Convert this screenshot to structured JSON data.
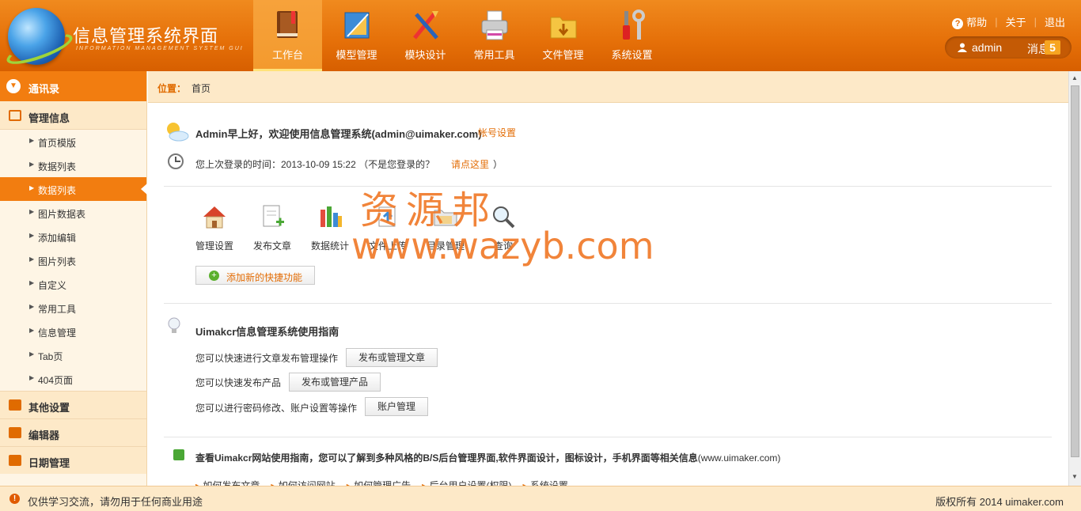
{
  "header": {
    "title": "信息管理系统界面",
    "subtitle": "INFORMATION MANAGEMENT SYSTEM GUI",
    "nav": [
      {
        "label": "工作台",
        "icon": "book-icon",
        "active": true
      },
      {
        "label": "模型管理",
        "icon": "ruler-icon",
        "active": false
      },
      {
        "label": "模块设计",
        "icon": "design-tools-icon",
        "active": false
      },
      {
        "label": "常用工具",
        "icon": "printer-icon",
        "active": false
      },
      {
        "label": "文件管理",
        "icon": "folder-icon",
        "active": false
      },
      {
        "label": "系统设置",
        "icon": "wrench-icon",
        "active": false
      }
    ],
    "top_links": {
      "help": "帮助",
      "about": "关于",
      "logout": "退出"
    },
    "user": {
      "name": "admin",
      "messages_label": "消息",
      "messages_count": "5"
    }
  },
  "sidebar": {
    "header": "通讯录",
    "group_main": "管理信息",
    "items": [
      "首页模版",
      "数据列表",
      "数据列表",
      "图片数据表",
      "添加编辑",
      "图片列表",
      "自定义",
      "常用工具",
      "信息管理",
      "Tab页",
      "404页面"
    ],
    "active_index": 2,
    "groups_bottom": [
      "其他设置",
      "编辑器",
      "日期管理"
    ]
  },
  "breadcrumb": {
    "label": "位置：",
    "home": "首页"
  },
  "main": {
    "welcome": "Admin早上好，欢迎使用信息管理系统(admin@uimaker.com)",
    "account_link": "帐号设置",
    "last_login_prefix": "您上次登录的时间：2013-10-09 15:22 （不是您登录的？",
    "last_login_link": "请点这里",
    "last_login_suffix": "）",
    "quick": [
      {
        "label": "管理设置",
        "icon": "home-icon"
      },
      {
        "label": "发布文章",
        "icon": "new-document-icon"
      },
      {
        "label": "数据统计",
        "icon": "bar-chart-icon"
      },
      {
        "label": "文件上传",
        "icon": "upload-icon"
      },
      {
        "label": "目录管理",
        "icon": "directory-icon"
      },
      {
        "label": "查询",
        "icon": "magnifier-icon"
      }
    ],
    "add_quick": "添加新的快捷功能",
    "guide_title": "Uimakcr信息管理系统使用指南",
    "guide_rows": [
      {
        "text": "您可以快速进行文章发布管理操作",
        "button": "发布或管理文章"
      },
      {
        "text": "您可以快速发布产品",
        "button": "发布或管理产品"
      },
      {
        "text": "您可以进行密码修改、账户设置等操作",
        "button": "账户管理"
      }
    ],
    "site_title_bold": "查看Uimakcr网站使用指南，您可以了解到多种风格的B/S后台管理界面,软件界面设计，图标设计，手机界面等相关信息",
    "site_title_normal": "(www.uimaker.com)",
    "site_links": [
      "如何发布文章",
      "如何访问网站",
      "如何管理广告",
      "后台用户设置(权限)",
      "系统设置"
    ]
  },
  "watermark": {
    "line1": "资源邦",
    "line2": "www.wazyb.com"
  },
  "footer": {
    "left": "仅供学习交流，请勿用于任何商业用途",
    "right": "版权所有 2014 uimaker.com"
  }
}
